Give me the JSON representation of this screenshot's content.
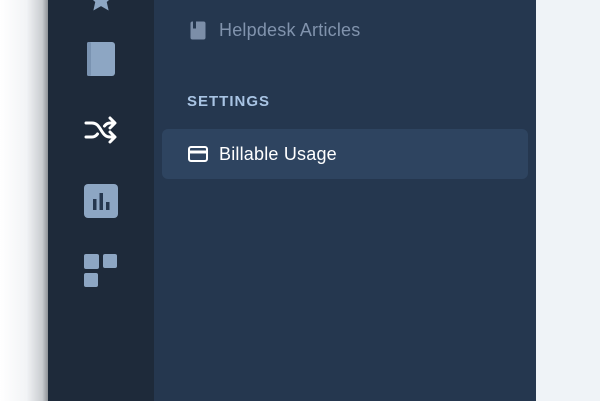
{
  "sidebar": {
    "icons": [
      {
        "name": "star-icon"
      },
      {
        "name": "book-icon"
      },
      {
        "name": "shuffle-icon"
      },
      {
        "name": "bar-chart-icon"
      },
      {
        "name": "dashboard-icon"
      }
    ]
  },
  "panel": {
    "items": [
      {
        "label": "Helpdesk Articles",
        "icon": "article-icon"
      }
    ],
    "section_title": "SETTINGS",
    "settings_items": [
      {
        "label": "Billable Usage",
        "icon": "credit-card-icon",
        "active": true
      }
    ]
  },
  "colors": {
    "rail_bg": "#1e2a3a",
    "panel_bg": "#25374f",
    "active_bg": "#2e4460",
    "icon_muted": "#8da6c3",
    "section_label": "#a9c4e4"
  }
}
